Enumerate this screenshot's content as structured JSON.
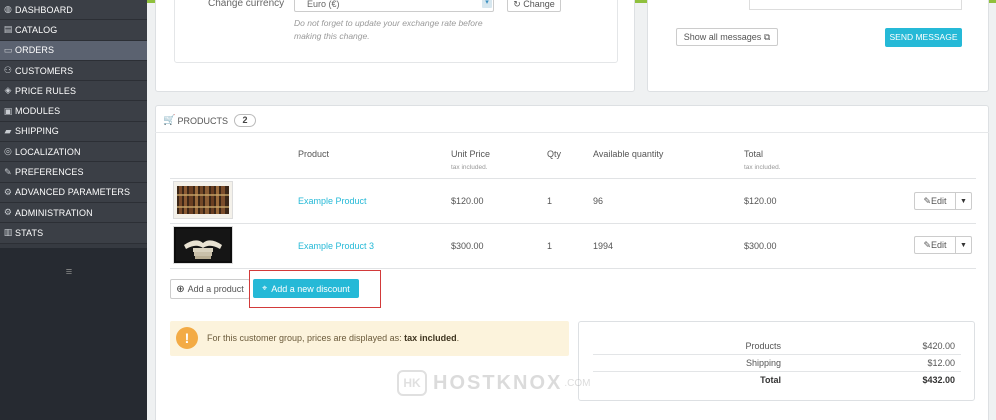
{
  "sidebar": {
    "items": [
      {
        "label": "DASHBOARD",
        "icon": "dashboard-icon",
        "glyph": "◍",
        "active": false
      },
      {
        "label": "CATALOG",
        "icon": "catalog-icon",
        "glyph": "▤",
        "active": false
      },
      {
        "label": "ORDERS",
        "icon": "orders-icon",
        "glyph": "▭",
        "active": true
      },
      {
        "label": "CUSTOMERS",
        "icon": "customers-icon",
        "glyph": "⚇",
        "active": false
      },
      {
        "label": "PRICE RULES",
        "icon": "price-rules-icon",
        "glyph": "◈",
        "active": false
      },
      {
        "label": "MODULES",
        "icon": "modules-icon",
        "glyph": "▣",
        "active": false
      },
      {
        "label": "SHIPPING",
        "icon": "shipping-icon",
        "glyph": "▰",
        "active": false
      },
      {
        "label": "LOCALIZATION",
        "icon": "localization-icon",
        "glyph": "◎",
        "active": false
      },
      {
        "label": "PREFERENCES",
        "icon": "preferences-icon",
        "glyph": "✎",
        "active": false
      },
      {
        "label": "ADVANCED PARAMETERS",
        "icon": "advanced-parameters-icon",
        "glyph": "⚙",
        "active": false
      },
      {
        "label": "ADMINISTRATION",
        "icon": "administration-icon",
        "glyph": "⚙",
        "active": false
      },
      {
        "label": "STATS",
        "icon": "stats-icon",
        "glyph": "▥",
        "active": false
      }
    ],
    "toggle_glyph": "≡"
  },
  "currency": {
    "label": "Change currency",
    "selected": "Euro (€)",
    "change_button": "Change",
    "help": "Do not forget to update your exchange rate before making this change."
  },
  "messages": {
    "show_all_button": "Show all messages",
    "send_button": "SEND MESSAGE"
  },
  "products": {
    "title": "PRODUCTS",
    "count": "2",
    "columns": {
      "product": "Product",
      "unit_price": "Unit Price",
      "unit_price_note": "tax included.",
      "qty": "Qty",
      "available": "Available quantity",
      "total": "Total",
      "total_note": "tax included."
    },
    "rows": [
      {
        "name": "Example Product",
        "unit_price": "$120.00",
        "qty": "1",
        "available": "96",
        "total": "$120.00",
        "edit": "Edit"
      },
      {
        "name": "Example Product 3",
        "unit_price": "$300.00",
        "qty": "1",
        "available": "1994",
        "total": "$300.00",
        "edit": "Edit"
      }
    ],
    "add_product_button": "Add a product",
    "add_discount_button": "Add a new discount"
  },
  "alert": {
    "text": "For this customer group, prices are displayed as:",
    "strong": "tax included",
    "end": "."
  },
  "totals": {
    "rows": [
      {
        "label": "Products",
        "value": "$420.00"
      },
      {
        "label": "Shipping",
        "value": "$12.00"
      },
      {
        "label": "Total",
        "value": "$432.00"
      }
    ]
  },
  "watermark": {
    "logo": "HK",
    "text": "HOSTKNOX",
    "suffix": ".COM"
  },
  "colors": {
    "accent": "#25b9d7",
    "sidebar": "#363a41",
    "top_strip": "#8fc03d",
    "highlight": "#d23a3a"
  }
}
